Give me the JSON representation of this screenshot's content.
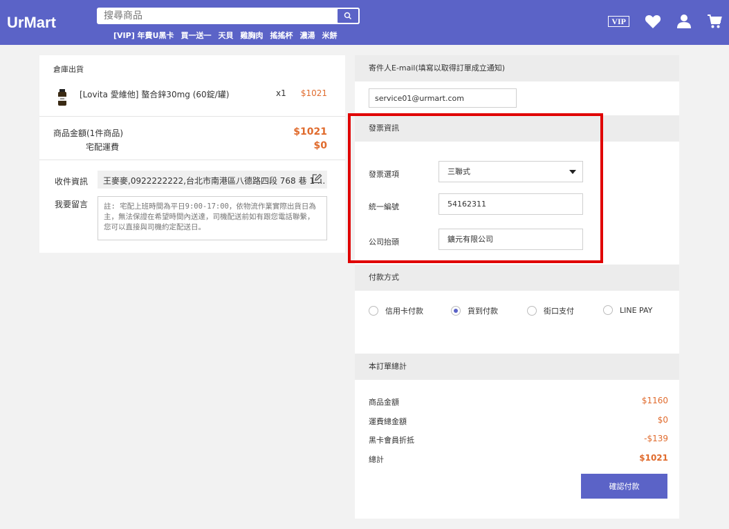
{
  "header": {
    "logo": "UrMart",
    "search_placeholder": "搜尋商品",
    "hot_links": [
      "[VIP] 年費U黑卡",
      "買一送一",
      "天貝",
      "雞胸肉",
      "搖搖杯",
      "濃湯",
      "米餅"
    ],
    "vip_label": "VIP",
    "icons": [
      "search-icon",
      "heart-icon",
      "user-icon",
      "cart-icon"
    ]
  },
  "order": {
    "warehouse_label": "倉庫出貨",
    "product": {
      "name": "[Lovita 愛維他] 螯合鋅30mg (60錠/罐)",
      "qty": "x1",
      "price": "$1021"
    },
    "subtotal_label": "商品金額(1件商品)",
    "subtotal_value": "$1021",
    "shipping_label": "宅配運費",
    "shipping_value": "$0",
    "recipient_label": "收件資訊",
    "recipient_value": "王麥麥,0922222222,台北市南港區八德路四段 768 巷 1 ...",
    "message_label": "我要留言",
    "message_placeholder": "註: 宅配上班時間為平日9:00-17:00，依物流作業實際出貨日為主，無法保證在希望時間內送達，司機配送前如有跟您電話聯繫，您可以直接與司機約定配送日。"
  },
  "email": {
    "label": "寄件人E-mail(填寫以取得訂單成立通知)",
    "value": "service01@urmart.com"
  },
  "invoice": {
    "section_label": "發票資訊",
    "type_label": "發票選項",
    "type_value": "三聯式",
    "tax_id_label": "統一編號",
    "tax_id_value": "54162311",
    "title_label": "公司抬頭",
    "title_value": "鑛元有限公司"
  },
  "payment": {
    "section_label": "付款方式",
    "options": [
      {
        "label": "信用卡付款",
        "selected": false
      },
      {
        "label": "貨到付款",
        "selected": true
      },
      {
        "label": "街口支付",
        "selected": false
      },
      {
        "label": "LINE PAY",
        "selected": false
      }
    ]
  },
  "totals": {
    "section_label": "本訂單總計",
    "rows": [
      {
        "label": "商品金額",
        "value": "$1160"
      },
      {
        "label": "運費總金額",
        "value": "$0"
      },
      {
        "label": "黑卡會員折抵",
        "value": "-$139"
      },
      {
        "label": "總計",
        "value": "$1021"
      }
    ],
    "confirm_label": "確認付款"
  },
  "colors": {
    "brand": "#5b63c7",
    "price": "#e06b2d",
    "highlight": "#e00000"
  }
}
